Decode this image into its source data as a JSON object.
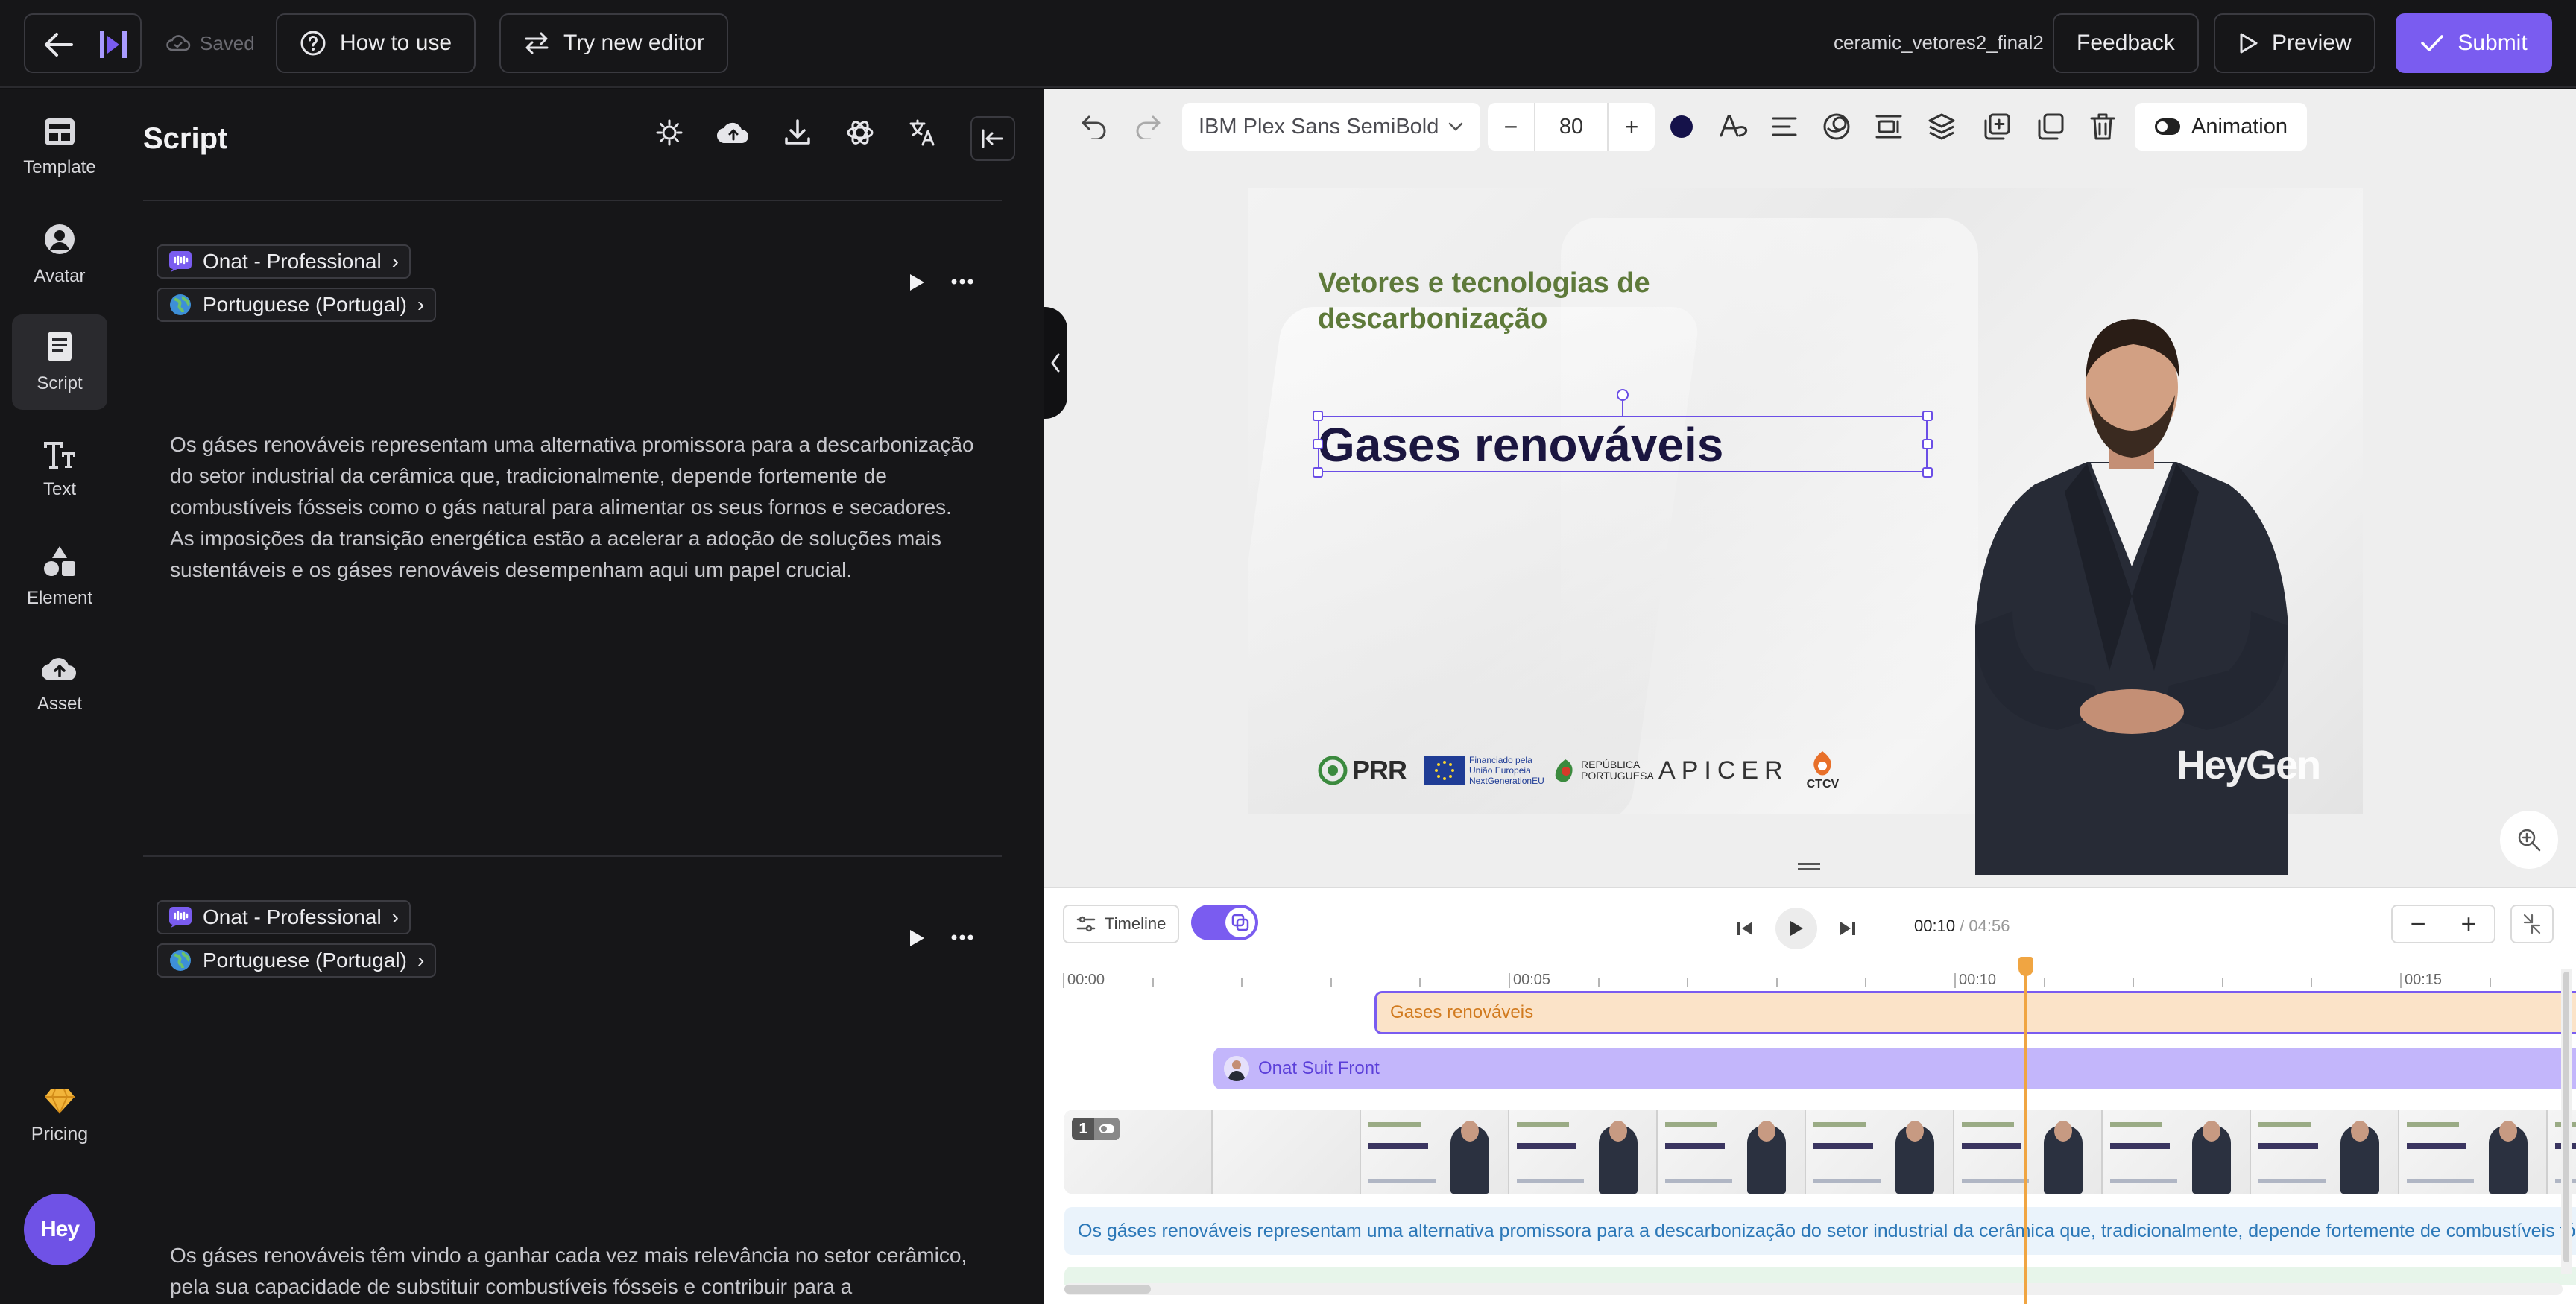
{
  "topbar": {
    "saved_label": "Saved",
    "how_to_use_label": "How to use",
    "try_editor_label": "Try new editor",
    "file_name": "ceramic_vetores2_final2",
    "feedback_label": "Feedback",
    "preview_label": "Preview",
    "submit_label": "Submit"
  },
  "nav": {
    "items": [
      {
        "label": "Template",
        "icon": "template-icon"
      },
      {
        "label": "Avatar",
        "icon": "avatar-icon"
      },
      {
        "label": "Script",
        "icon": "script-icon",
        "active": true
      },
      {
        "label": "Text",
        "icon": "text-icon"
      },
      {
        "label": "Element",
        "icon": "element-icon"
      },
      {
        "label": "Asset",
        "icon": "asset-icon"
      }
    ],
    "pricing_label": "Pricing",
    "hey_label": "Hey"
  },
  "script": {
    "title": "Script",
    "segments": [
      {
        "voice": "Onat - Professional",
        "language": "Portuguese (Portugal)",
        "text": "Os gáses renováveis representam uma alternativa promissora para a descarbonização do setor industrial da cerâmica que, tradicionalmente, depende fortemente de combustíveis fósseis como o gás natural para alimentar os seus fornos e secadores. As imposições da transição energética estão a acelerar a adoção de soluções mais sustentáveis e os gáses renováveis desempenham aqui um papel crucial."
      },
      {
        "voice": "Onat - Professional",
        "language": "Portuguese (Portugal)",
        "text": "Os gáses renováveis têm vindo a ganhar cada vez mais relevância no setor cerâmico, pela sua capacidade de substituir combustíveis fósseis e contribuir para a"
      }
    ]
  },
  "toolbar": {
    "font_family": "IBM Plex Sans SemiBold",
    "font_size": "80",
    "minus": "−",
    "plus": "+",
    "text_color": "#15124a",
    "animation_label": "Animation"
  },
  "slide": {
    "subtitle": "Vetores e tecnologias de descarbonização",
    "title": "Gases renováveis",
    "logos": {
      "prr": "PRR",
      "eu": "Financiado pela União Europeia",
      "eu_sub": "NextGenerationEU",
      "rp": "REPÚBLICA PORTUGUESA",
      "apicer": "APICER",
      "ctcv": "CTCV"
    },
    "watermark": "HeyGen"
  },
  "timeline": {
    "timeline_label": "Timeline",
    "current_time": "00:10",
    "total_time": "04:56",
    "ruler_labels": [
      "00:00",
      "00:05",
      "00:10",
      "00:15"
    ],
    "text_track": "Gases renováveis",
    "avatar_track": "Onat Suit Front",
    "scene_number": "1",
    "script_track": "Os gáses renováveis representam uma alternativa promissora para a descarbonização do setor industrial da cerâmica que, tradicionalmente, depende fortemente de combustíveis fósseis"
  },
  "colors": {
    "accent": "#7a5cf0",
    "text_track_bg": "#fbe3c8",
    "avatar_track_bg": "#c3b6fb",
    "playhead": "#f0a542",
    "slide_subtitle": "#5e7a3a",
    "slide_title": "#1b1640"
  }
}
